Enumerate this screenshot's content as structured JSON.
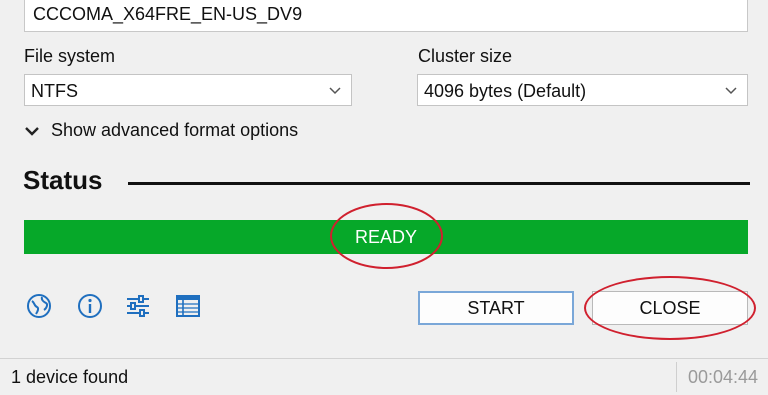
{
  "volume_label": {
    "value": "CCCOMA_X64FRE_EN-US_DV9"
  },
  "file_system": {
    "label": "File system",
    "value": "NTFS"
  },
  "cluster_size": {
    "label": "Cluster size",
    "value": "4096 bytes (Default)"
  },
  "advanced_toggle": {
    "label": "Show advanced format options"
  },
  "status": {
    "heading": "Status",
    "progress_text": "READY",
    "progress_fraction": 1.0,
    "progress_color": "#06a829"
  },
  "toolbar": {
    "icons": [
      "globe-icon",
      "info-icon",
      "settings-sliders-icon",
      "log-table-icon"
    ],
    "icon_color": "#1f6fbf"
  },
  "buttons": {
    "start": "START",
    "close": "CLOSE"
  },
  "statusbar": {
    "devices": "1 device found",
    "timer": "00:04:44"
  },
  "annotation_color": "#d0202e"
}
